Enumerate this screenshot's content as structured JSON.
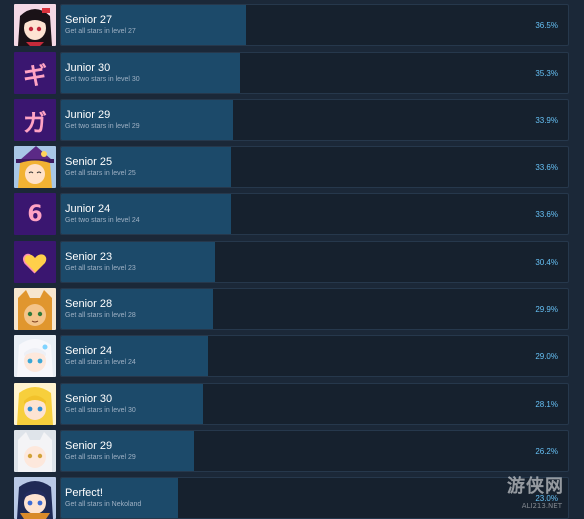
{
  "achievements": [
    {
      "title": "Senior 27",
      "description": "Get all stars in level 27",
      "percent_label": "36.5%",
      "percent": 36.5,
      "icon": "anime-girl-avatar-icon"
    },
    {
      "title": "Junior 30",
      "description": "Get two stars in level 30",
      "percent_label": "35.3%",
      "percent": 35.3,
      "icon": "katakana-gi-icon",
      "glyph": "ギ"
    },
    {
      "title": "Junior 29",
      "description": "Get two stars in level 29",
      "percent_label": "33.9%",
      "percent": 33.9,
      "icon": "katakana-ga-icon",
      "glyph": "ガ"
    },
    {
      "title": "Senior 25",
      "description": "Get all stars in level 25",
      "percent_label": "33.6%",
      "percent": 33.6,
      "icon": "witch-girl-avatar-icon"
    },
    {
      "title": "Junior 24",
      "description": "Get two stars in level 24",
      "percent_label": "33.6%",
      "percent": 33.6,
      "icon": "number-six-icon",
      "glyph": "6"
    },
    {
      "title": "Senior 23",
      "description": "Get all stars in level 23",
      "percent_label": "30.4%",
      "percent": 30.4,
      "icon": "heart-icon"
    },
    {
      "title": "Senior 28",
      "description": "Get all stars in level 28",
      "percent_label": "29.9%",
      "percent": 29.9,
      "icon": "fox-girl-avatar-icon"
    },
    {
      "title": "Senior 24",
      "description": "Get all stars in level 24",
      "percent_label": "29.0%",
      "percent": 29.0,
      "icon": "white-hair-girl-avatar-icon"
    },
    {
      "title": "Senior 30",
      "description": "Get all stars in level 30",
      "percent_label": "28.1%",
      "percent": 28.1,
      "icon": "blonde-girl-avatar-icon"
    },
    {
      "title": "Senior 29",
      "description": "Get all stars in level 29",
      "percent_label": "26.2%",
      "percent": 26.2,
      "icon": "white-cat-girl-avatar-icon"
    },
    {
      "title": "Perfect!",
      "description": "Get all stars in Nekoland",
      "percent_label": "23.0%",
      "percent": 23.0,
      "icon": "dark-hair-girl-avatar-icon"
    }
  ],
  "watermark": {
    "text": "游侠网",
    "sub": "ALI213.NET"
  },
  "colors": {
    "background": "#1b2838",
    "bar": "#16212e",
    "fill": "#1c4a6a",
    "percent": "#66c0f4",
    "pixel_icon_bg": "#3a1670",
    "pixel_glyph": "#ffa3c4"
  }
}
